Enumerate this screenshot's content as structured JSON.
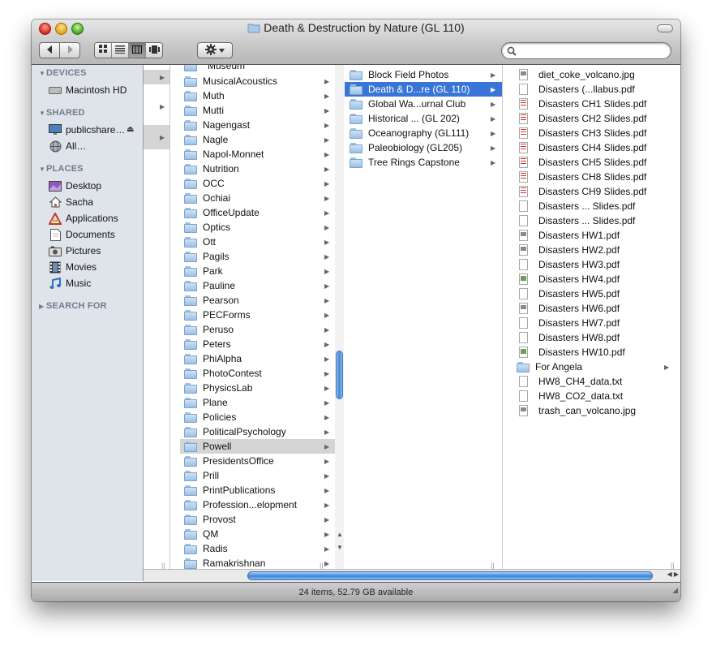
{
  "window": {
    "title": "Death & Destruction by Nature (GL 110)"
  },
  "toolbar": {
    "back_icon": "back-arrow-icon",
    "forward_icon": "forward-arrow-icon",
    "view_modes": [
      "icon-view",
      "list-view",
      "column-view",
      "coverflow-view"
    ],
    "active_view": "column-view",
    "action_icon": "gear-icon",
    "search_placeholder": ""
  },
  "sidebar": {
    "sections": [
      {
        "title": "DEVICES",
        "items": [
          {
            "label": "Macintosh HD",
            "icon": "hard-drive-icon"
          }
        ]
      },
      {
        "title": "SHARED",
        "items": [
          {
            "label": "publicshare…",
            "icon": "network-display-icon",
            "eject": "⏏"
          },
          {
            "label": "All…",
            "icon": "network-globe-icon"
          }
        ]
      },
      {
        "title": "PLACES",
        "items": [
          {
            "label": "Desktop",
            "icon": "desktop-icon"
          },
          {
            "label": "Sacha",
            "icon": "home-icon"
          },
          {
            "label": "Applications",
            "icon": "applications-icon"
          },
          {
            "label": "Documents",
            "icon": "documents-icon"
          },
          {
            "label": "Pictures",
            "icon": "pictures-icon"
          },
          {
            "label": "Movies",
            "icon": "movies-icon"
          },
          {
            "label": "Music",
            "icon": "music-icon"
          }
        ]
      },
      {
        "title": "SEARCH FOR",
        "collapsed": true,
        "items": []
      }
    ]
  },
  "columns": {
    "c2": {
      "partial_top": "Museum",
      "items": [
        "MusicalAcoustics",
        "Muth",
        "Mutti",
        "Nagengast",
        "Nagle",
        "Napol-Monnet",
        "Nutrition",
        "OCC",
        "Ochiai",
        "OfficeUpdate",
        "Optics",
        "Ott",
        "Pagils",
        "Park",
        "Pauline",
        "Pearson",
        "PECForms",
        "Peruso",
        "Peters",
        "PhiAlpha",
        "PhotoContest",
        "PhysicsLab",
        "Plane",
        "Policies",
        "PoliticalPsychology",
        "Powell",
        "PresidentsOffice",
        "Prill",
        "PrintPublications",
        "Profession...elopment",
        "Provost",
        "QM",
        "Radis",
        "Ramakrishnan"
      ],
      "selected": "Powell"
    },
    "c3": {
      "items": [
        "Block Field Photos",
        "Death & D...re (GL 110)",
        "Global Wa...urnal Club",
        "Historical ... (GL 202)",
        "Oceanography (GL111)",
        "Paleobiology (GL205)",
        "Tree Rings Capstone"
      ],
      "selected": "Death & D...re (GL 110)"
    },
    "c4": {
      "items": [
        {
          "name": "diet_coke_volcano.jpg",
          "kind": "image"
        },
        {
          "name": "Disasters (...llabus.pdf",
          "kind": "pdf"
        },
        {
          "name": "Disasters CH1 Slides.pdf",
          "kind": "pdf-slides"
        },
        {
          "name": "Disasters CH2 Slides.pdf",
          "kind": "pdf-slides"
        },
        {
          "name": "Disasters CH3 Slides.pdf",
          "kind": "pdf-slides"
        },
        {
          "name": "Disasters CH4 Slides.pdf",
          "kind": "pdf-slides"
        },
        {
          "name": "Disasters CH5 Slides.pdf",
          "kind": "pdf-slides"
        },
        {
          "name": "Disasters CH8 Slides.pdf",
          "kind": "pdf-slides"
        },
        {
          "name": "Disasters CH9 Slides.pdf",
          "kind": "pdf-slides"
        },
        {
          "name": "Disasters ... Slides.pdf",
          "kind": "pdf"
        },
        {
          "name": "Disasters ... Slides.pdf",
          "kind": "pdf"
        },
        {
          "name": "Disasters HW1.pdf",
          "kind": "pdf-image"
        },
        {
          "name": "Disasters HW2.pdf",
          "kind": "pdf-image"
        },
        {
          "name": "Disasters HW3.pdf",
          "kind": "pdf"
        },
        {
          "name": "Disasters HW4.pdf",
          "kind": "pdf-green"
        },
        {
          "name": "Disasters HW5.pdf",
          "kind": "pdf"
        },
        {
          "name": "Disasters HW6.pdf",
          "kind": "pdf-image"
        },
        {
          "name": "Disasters HW7.pdf",
          "kind": "pdf"
        },
        {
          "name": "Disasters HW8.pdf",
          "kind": "pdf"
        },
        {
          "name": "Disasters HW10.pdf",
          "kind": "pdf-green"
        },
        {
          "name": "For Angela",
          "kind": "folder"
        },
        {
          "name": "HW8_CH4_data.txt",
          "kind": "text"
        },
        {
          "name": "HW8_CO2_data.txt",
          "kind": "text"
        },
        {
          "name": "trash_can_volcano.jpg",
          "kind": "image"
        }
      ]
    }
  },
  "status": {
    "text": "24 items, 52.79 GB available"
  },
  "colors": {
    "selection": "#3875d7",
    "sidebar_bg": "#dfe4ea",
    "sidebar_heading": "#6f7c8c"
  }
}
